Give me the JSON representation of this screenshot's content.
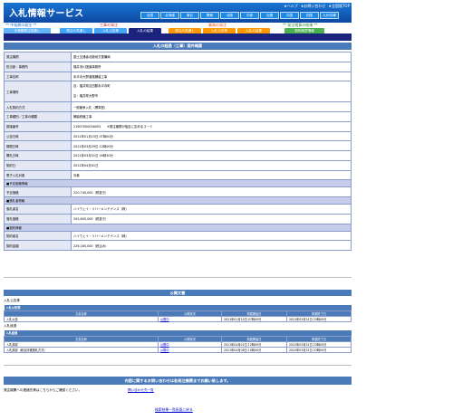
{
  "header": {
    "site_title": "入札情報サービス",
    "util_links": [
      "★ヘルプ",
      "★お問い合わせ",
      "★全国版TOP"
    ],
    "regions": [
      "全国",
      "北海道",
      "東北",
      "関東",
      "北陸",
      "中部",
      "近畿",
      "中国",
      "四国",
      "九州沖縄"
    ]
  },
  "categories": [
    {
      "label": "** 中長期の発注 **",
      "color": "#1565c0"
    },
    {
      "label": "工事の発注",
      "color": "#c62828"
    },
    {
      "label": "業務の発注",
      "color": "#e65100"
    },
    {
      "label": "** 発注随意の結果 **",
      "color": "#2e7d32"
    }
  ],
  "tabs": [
    {
      "label": "中長期発注見通し",
      "color": "#64b5f6"
    },
    {
      "label": "発注の見通し",
      "color": "#42a5f5"
    },
    {
      "label": "入札公告等",
      "color": "#42a5f5"
    },
    {
      "label": "入札の結果",
      "color": "#1a237e"
    },
    {
      "label": "発注の見通し",
      "color": "#ff9800"
    },
    {
      "label": "入札公告等",
      "color": "#ff9800"
    },
    {
      "label": "入札の結果",
      "color": "#ff9800"
    },
    {
      "label": "契約随意情報",
      "color": "#4caf50"
    }
  ],
  "page_title": "入札の経過（工事）案件概要",
  "details": [
    {
      "label": "発注機関",
      "value": "国土交通省北陸地方整備局"
    },
    {
      "label": "担当部・事務所",
      "value": "福井河川国道事務所"
    },
    {
      "label": "工事名称",
      "value": "永平寺大野道路舗装工事"
    },
    {
      "label": "工事場所",
      "values": [
        "自：福井県吉田郡永平寺町",
        "至：福井県大野市"
      ]
    },
    {
      "label": "入札契約方式",
      "value": "一般競争入札（標準型）"
    },
    {
      "label": "工事種別／工事の種類",
      "value": "舗装修繕工事"
    },
    {
      "label": "調達番号",
      "value": "21807000036003　　※発注機関が独自に定めるコード"
    },
    {
      "label": "公告日時",
      "value": "2021年01月15日 07時00分"
    },
    {
      "label": "期限日時",
      "value": "2021年03月29日 12時00分"
    },
    {
      "label": "開札日時",
      "value": "2021年03月31日 16時30分"
    },
    {
      "label": "契約日",
      "value": "2021年04月01日"
    },
    {
      "label": "電子入札対象",
      "value": "対象"
    }
  ],
  "groups": {
    "estimate": {
      "title": "■予定価格情報",
      "label": "予定価格",
      "value": "220,740,000（税抜き）"
    },
    "winner": {
      "title": "■落札者情報",
      "label1": "落札者名",
      "value1": "ハイウェイ・リバーメンテナンス（株）",
      "label2": "落札価格",
      "value2": "205,600,000（税抜き）"
    },
    "contract": {
      "title": "■契約情報",
      "label1": "契約者名",
      "value1": "ハイウェイ・リバーメンテナンス（株）",
      "label2": "契約金額",
      "value2": "226,160,000（税込み）"
    }
  },
  "documents": {
    "title": "公開文書",
    "section1": {
      "title": "入札公告等",
      "caption": "入札公告等",
      "headers": [
        "文書名称",
        "公開状況",
        "掲載開始日",
        "掲載終了日"
      ],
      "rows": [
        [
          "入札公告",
          "公開中",
          "2021年01月15日 07時00分",
          "2021年03月31日 23時00分"
        ]
      ]
    },
    "section2": {
      "title": "入札経過",
      "caption": "入札経過",
      "headers": [
        "文書名称",
        "公開状況",
        "掲載開始日",
        "掲載終了日"
      ],
      "rows": [
        [
          "入札調書",
          "公開中",
          "2021年04月01日 12時00分",
          "2022年03月31日 23時00分"
        ],
        [
          "入札調書（総合評価落札方式）",
          "公開中",
          "2021年04月06日 10時40分",
          "2022年03月31日 23時00分"
        ]
      ]
    }
  },
  "inquiry": {
    "header": "内容に関するお問い合わせは各発注機関までお願い致します。",
    "text": "発注機関への連絡先等はこちらからご確認ください。",
    "link": "問い合わせ先一覧"
  },
  "back_link": "検索結果一覧画面に戻る"
}
